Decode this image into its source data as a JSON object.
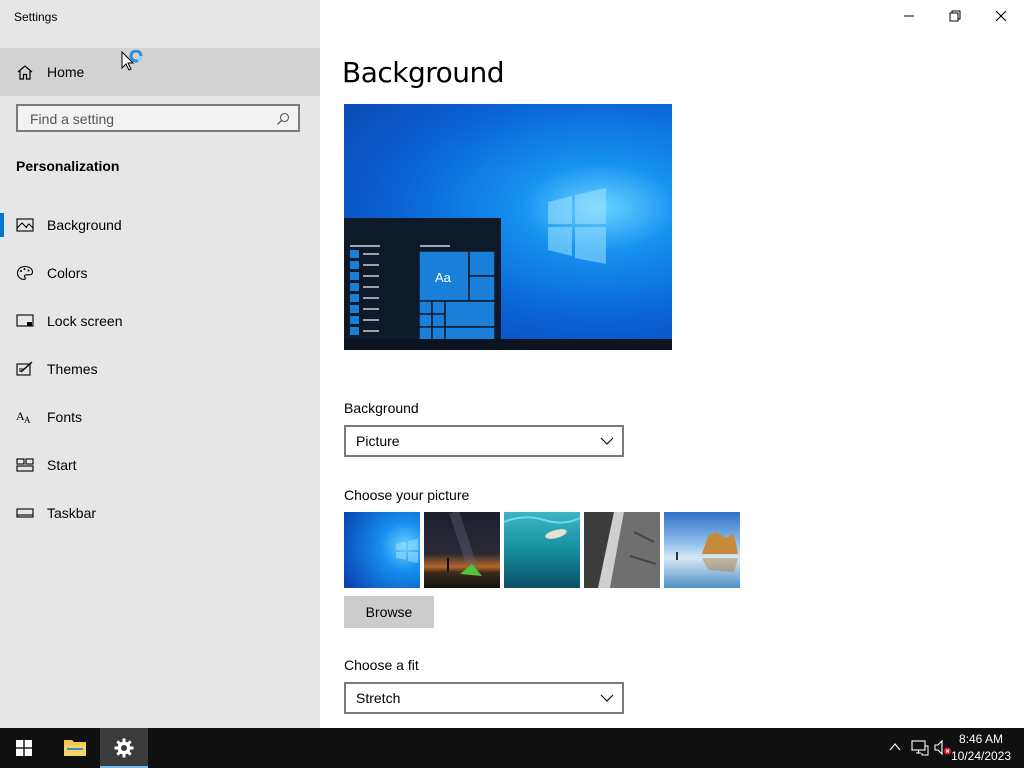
{
  "window": {
    "app_title": "Settings",
    "minimize_icon": "minimize-icon",
    "maximize_icon": "restore-icon",
    "close_icon": "close-icon"
  },
  "sidebar": {
    "home_label": "Home",
    "search_placeholder": "Find a setting",
    "section_title": "Personalization",
    "items": [
      {
        "label": "Background",
        "icon": "picture-icon",
        "active": true
      },
      {
        "label": "Colors",
        "icon": "palette-icon",
        "active": false
      },
      {
        "label": "Lock screen",
        "icon": "lock-screen-icon",
        "active": false
      },
      {
        "label": "Themes",
        "icon": "themes-icon",
        "active": false
      },
      {
        "label": "Fonts",
        "icon": "fonts-icon",
        "active": false
      },
      {
        "label": "Start",
        "icon": "start-icon",
        "active": false
      },
      {
        "label": "Taskbar",
        "icon": "taskbar-icon",
        "active": false
      }
    ]
  },
  "main": {
    "title": "Background",
    "preview_tile_text": "Aa",
    "background_label": "Background",
    "background_value": "Picture",
    "choose_picture_label": "Choose your picture",
    "pictures": [
      "windows-blue",
      "night-sky-tent",
      "underwater-swimmer",
      "rock-cliff",
      "beach-rocks"
    ],
    "browse_label": "Browse",
    "fit_label": "Choose a fit",
    "fit_value": "Stretch"
  },
  "taskbar": {
    "apps": [
      "start-icon",
      "file-explorer-icon",
      "settings-icon"
    ],
    "tray": [
      "chevron-up-icon",
      "network-icon",
      "volume-muted-icon"
    ],
    "time": "8:46 AM",
    "date": "10/24/2023"
  },
  "colors": {
    "accent": "#0078d7",
    "sidebar_bg": "#e6e6e6",
    "taskbar_bg": "#101010"
  }
}
